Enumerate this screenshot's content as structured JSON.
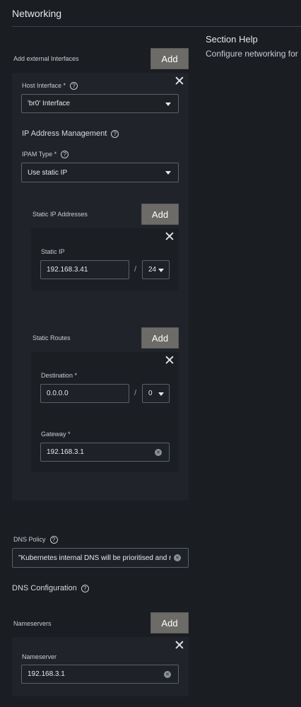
{
  "header": {
    "title": "Networking"
  },
  "help": {
    "title": "Section Help",
    "text": "Configure networking for"
  },
  "external_interfaces": {
    "label": "Add external Interfaces",
    "add_label": "Add",
    "item": {
      "host_interface_label": "Host Interface *",
      "host_interface_value": "'br0' Interface",
      "ipam_title": "IP Address Management",
      "ipam_type_label": "IPAM Type *",
      "ipam_type_value": "Use static IP",
      "static_ips": {
        "label": "Static IP Addresses",
        "add_label": "Add",
        "item": {
          "label": "Static IP",
          "ip": "192.168.3.41",
          "separator": "/",
          "mask": "24"
        }
      },
      "static_routes": {
        "label": "Static Routes",
        "add_label": "Add",
        "item": {
          "destination_label": "Destination *",
          "destination": "0.0.0.0",
          "separator": "/",
          "mask": "0",
          "gateway_label": "Gateway *",
          "gateway": "192.168.3.1"
        }
      }
    }
  },
  "dns_policy": {
    "label": "DNS Policy",
    "value": "\"Kubernetes internal DNS will be prioritised and r"
  },
  "dns_config": {
    "title": "DNS Configuration"
  },
  "nameservers": {
    "label": "Nameservers",
    "add_label": "Add",
    "item": {
      "label": "Nameserver",
      "value": "192.168.3.1"
    }
  },
  "icons": {
    "close": "close-icon",
    "help": "help-icon",
    "dropdown": "chevron-down-icon",
    "clear": "clear-icon"
  },
  "colors": {
    "background": "#1a1d22",
    "panel": "#20242a",
    "button": "#6d6b68",
    "text": "#d7dadf"
  }
}
